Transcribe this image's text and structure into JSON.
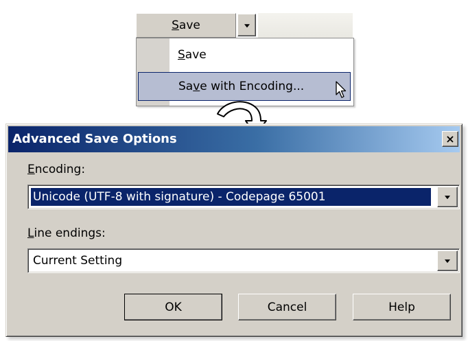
{
  "save_button": {
    "pre": "",
    "accel": "S",
    "post": "ave"
  },
  "menu": {
    "save": {
      "pre": "",
      "accel": "S",
      "post": "ave"
    },
    "save_with_encoding": {
      "pre": "Sa",
      "accel": "v",
      "post": "e with Encoding..."
    }
  },
  "dialog": {
    "title": "Advanced Save Options",
    "close_glyph": "×",
    "encoding_label": {
      "pre": "",
      "accel": "E",
      "post": "ncoding:"
    },
    "encoding_value": "Unicode (UTF-8 with signature) - Codepage 65001",
    "line_endings_label": {
      "pre": "",
      "accel": "L",
      "post": "ine endings:"
    },
    "line_endings_value": "Current Setting",
    "ok_label": "OK",
    "cancel_label": "Cancel",
    "help_label": "Help"
  },
  "icons": {
    "dropdown": "chevron-down-icon",
    "cursor": "mouse-pointer-icon",
    "transition": "curved-arrow-icon",
    "close": "close-icon"
  },
  "colors": {
    "selection": "#0a246a",
    "menu_highlight": "#b6bdd2",
    "face": "#d4d0c8"
  }
}
